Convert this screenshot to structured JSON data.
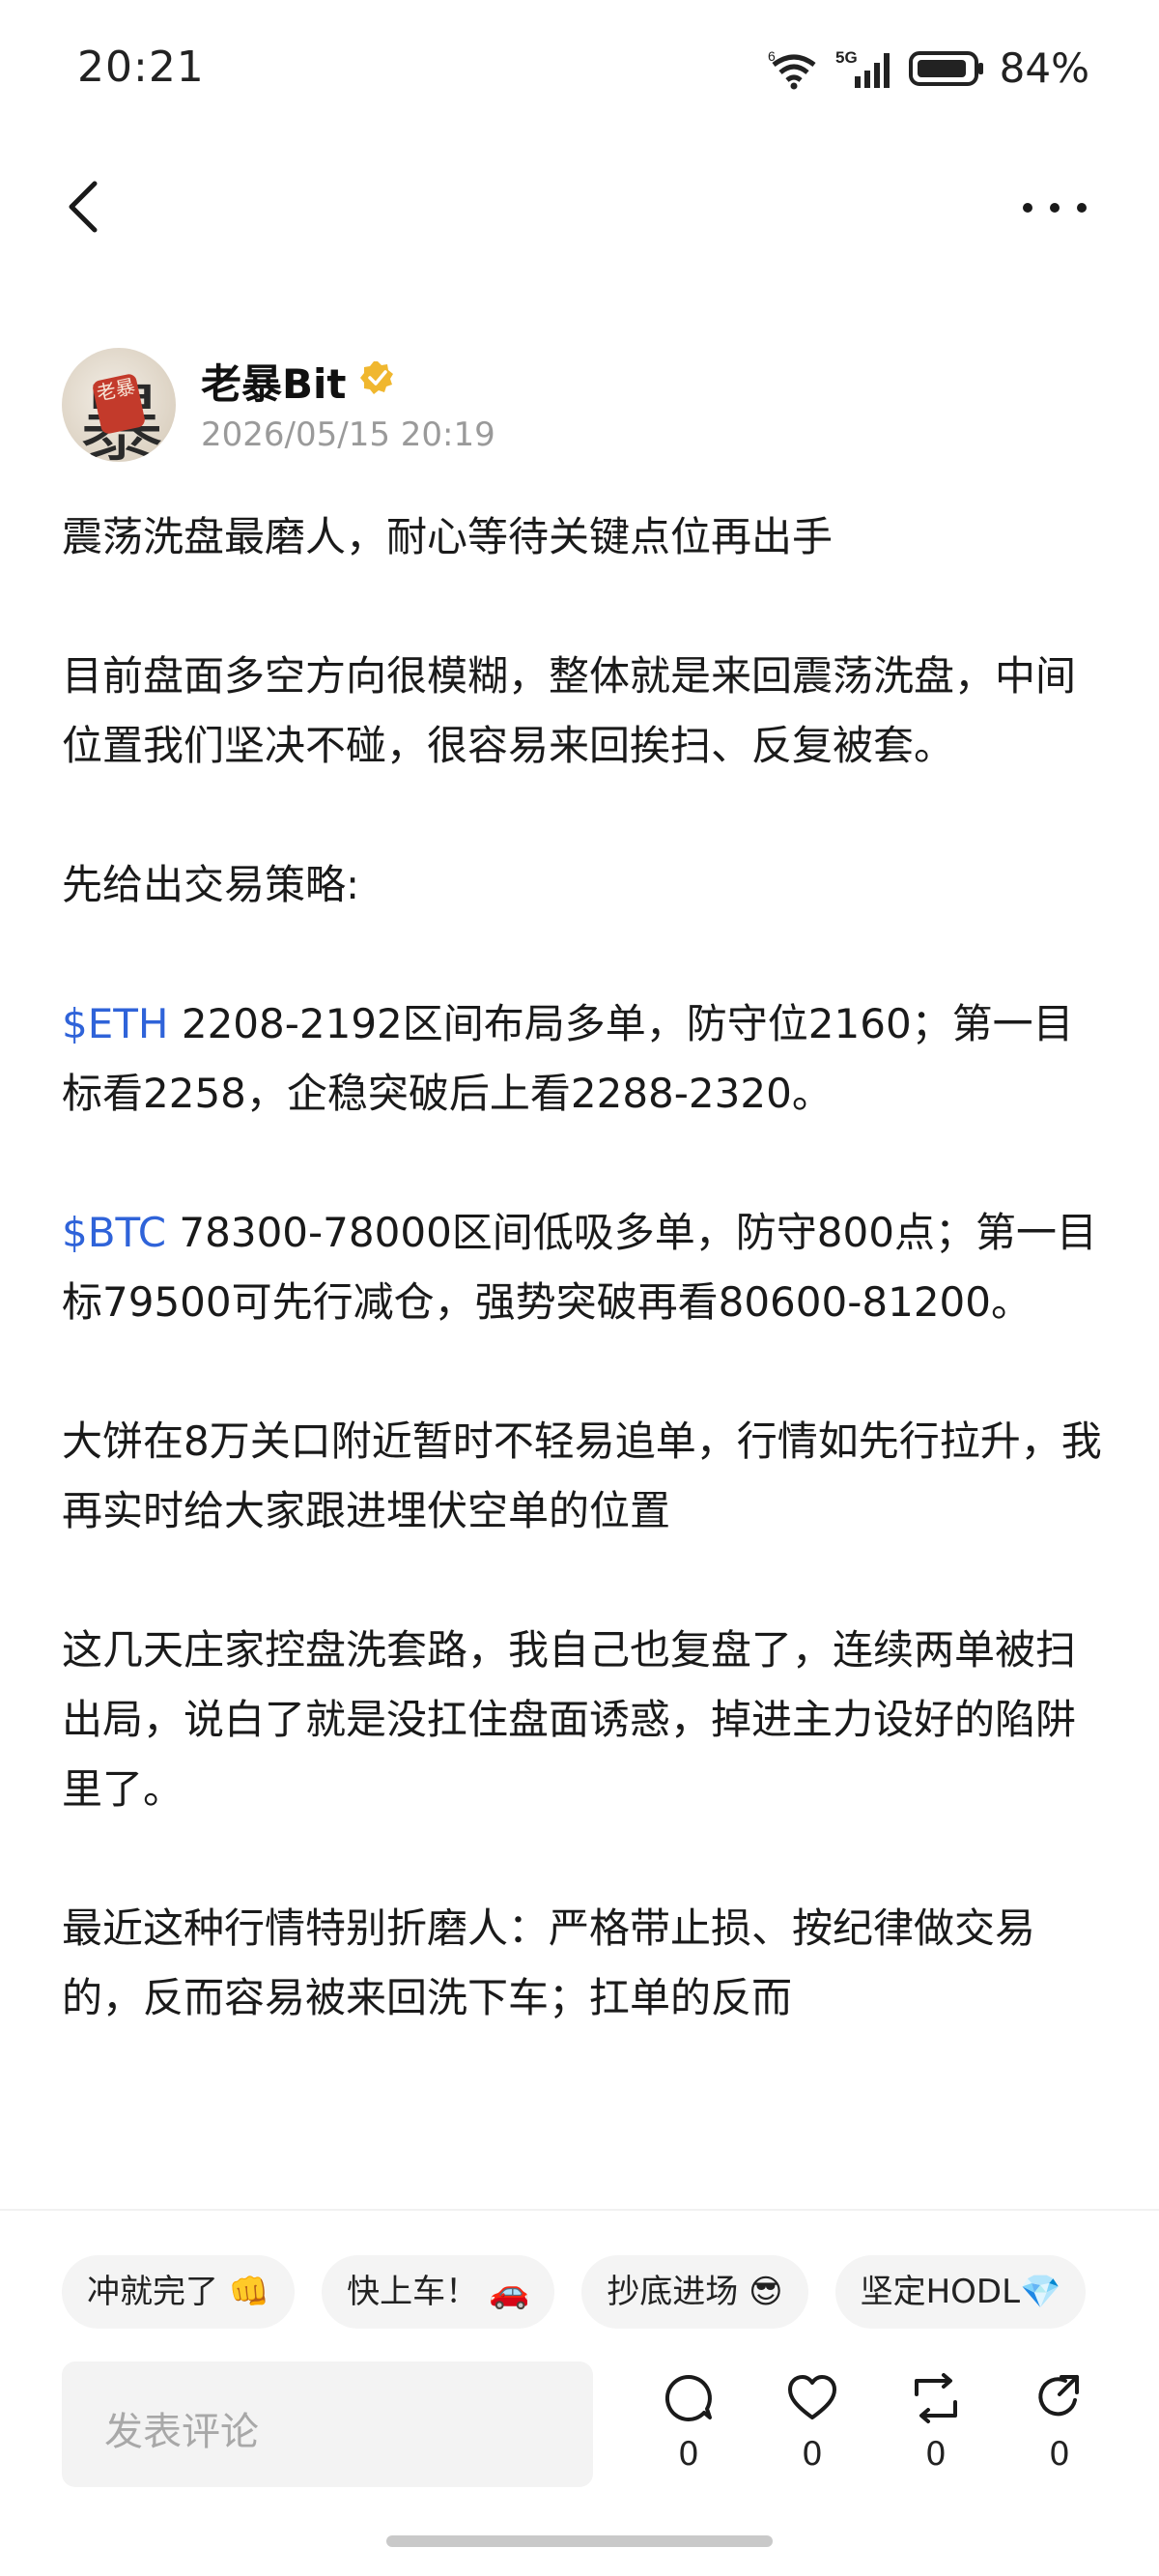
{
  "status": {
    "time": "20:21",
    "battery": "84%",
    "network": "5G",
    "wifi_badge": "6"
  },
  "author": {
    "name": "老暴Bit",
    "time": "2026/05/15 20:19",
    "avatar_text": "暴",
    "avatar_seal": "老暴"
  },
  "post": {
    "p1": "震荡洗盘最磨人，耐心等待关键点位再出手",
    "p2": "目前盘面多空方向很模糊，整体就是来回震荡洗盘，中间位置我们坚决不碰，很容易来回挨扫、反复被套。",
    "p3": "先给出交易策略:",
    "eth_tag": "$ETH",
    "eth_text": "  2208-2192区间布局多单，防守位2160；第一目标看2258，企稳突破后上看2288-2320。",
    "btc_tag": "$BTC",
    "btc_text": "  78300-78000区间低吸多单，防守800点；第一目标79500可先行减仓，强势突破再看80600-81200。",
    "p6": "大饼在8万关口附近暂时不轻易追单，行情如先行拉升，我再实时给大家跟进埋伏空单的位置",
    "p7": "这几天庄家控盘洗套路，我自己也复盘了，连续两单被扫出局，说白了就是没扛住盘面诱惑，掉进主力设好的陷阱里了。",
    "p8": "最近这种行情特别折磨人：严格带止损、按纪律做交易的，反而容易被来回洗下车；扛单的反而"
  },
  "chips": [
    "冲就完了 👊",
    "快上车！ 🚗",
    "抄底进场 😎",
    "坚定HODL💎"
  ],
  "comment": {
    "placeholder": "发表评论"
  },
  "actions": {
    "comment_count": "0",
    "like_count": "0",
    "repost_count": "0",
    "share_count": "0"
  },
  "colors": {
    "tag": "#2f63d9",
    "verified": "#f0b72f",
    "seal": "#c33a2b"
  },
  "icons": [
    "back-icon",
    "more-icon",
    "verified-icon",
    "comment-icon",
    "like-icon",
    "repost-icon",
    "share-icon",
    "wifi-icon",
    "signal-icon",
    "battery-icon"
  ]
}
